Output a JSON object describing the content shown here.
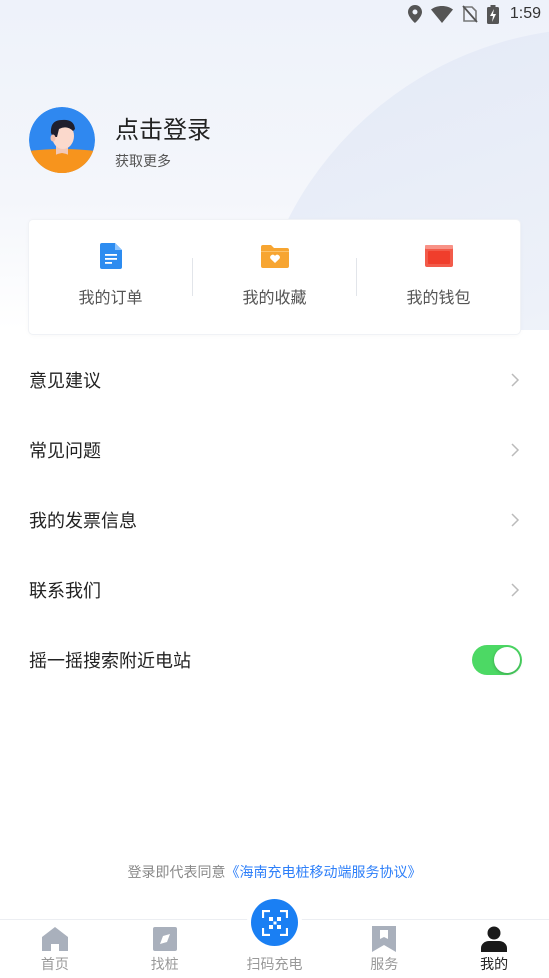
{
  "status_bar": {
    "time": "1:59"
  },
  "profile": {
    "title": "点击登录",
    "subtitle": "获取更多"
  },
  "quick": [
    {
      "label": "我的订单",
      "icon": "document-icon",
      "color": "#2d8cf0"
    },
    {
      "label": "我的收藏",
      "icon": "heart-folder-icon",
      "color": "#f7a531"
    },
    {
      "label": "我的钱包",
      "icon": "wallet-icon",
      "color": "#f25b4a"
    }
  ],
  "menu": [
    {
      "label": "意见建议"
    },
    {
      "label": "常见问题"
    },
    {
      "label": "我的发票信息"
    },
    {
      "label": "联系我们"
    },
    {
      "label": "摇一摇搜索附近电站",
      "toggle_on": true
    }
  ],
  "agreement": {
    "prefix": "登录即代表同意",
    "link": "《海南充电桩移动端服务协议》"
  },
  "tabs": [
    {
      "label": "首页",
      "icon": "home-icon"
    },
    {
      "label": "找桩",
      "icon": "compass-icon"
    },
    {
      "label": "扫码充电",
      "icon": "scan-icon"
    },
    {
      "label": "服务",
      "icon": "bookmark-icon"
    },
    {
      "label": "我的",
      "icon": "user-icon",
      "active": true
    }
  ],
  "colors": {
    "accent": "#1a7ff3",
    "toggle": "#4cd964",
    "link": "#2d7ff9"
  }
}
